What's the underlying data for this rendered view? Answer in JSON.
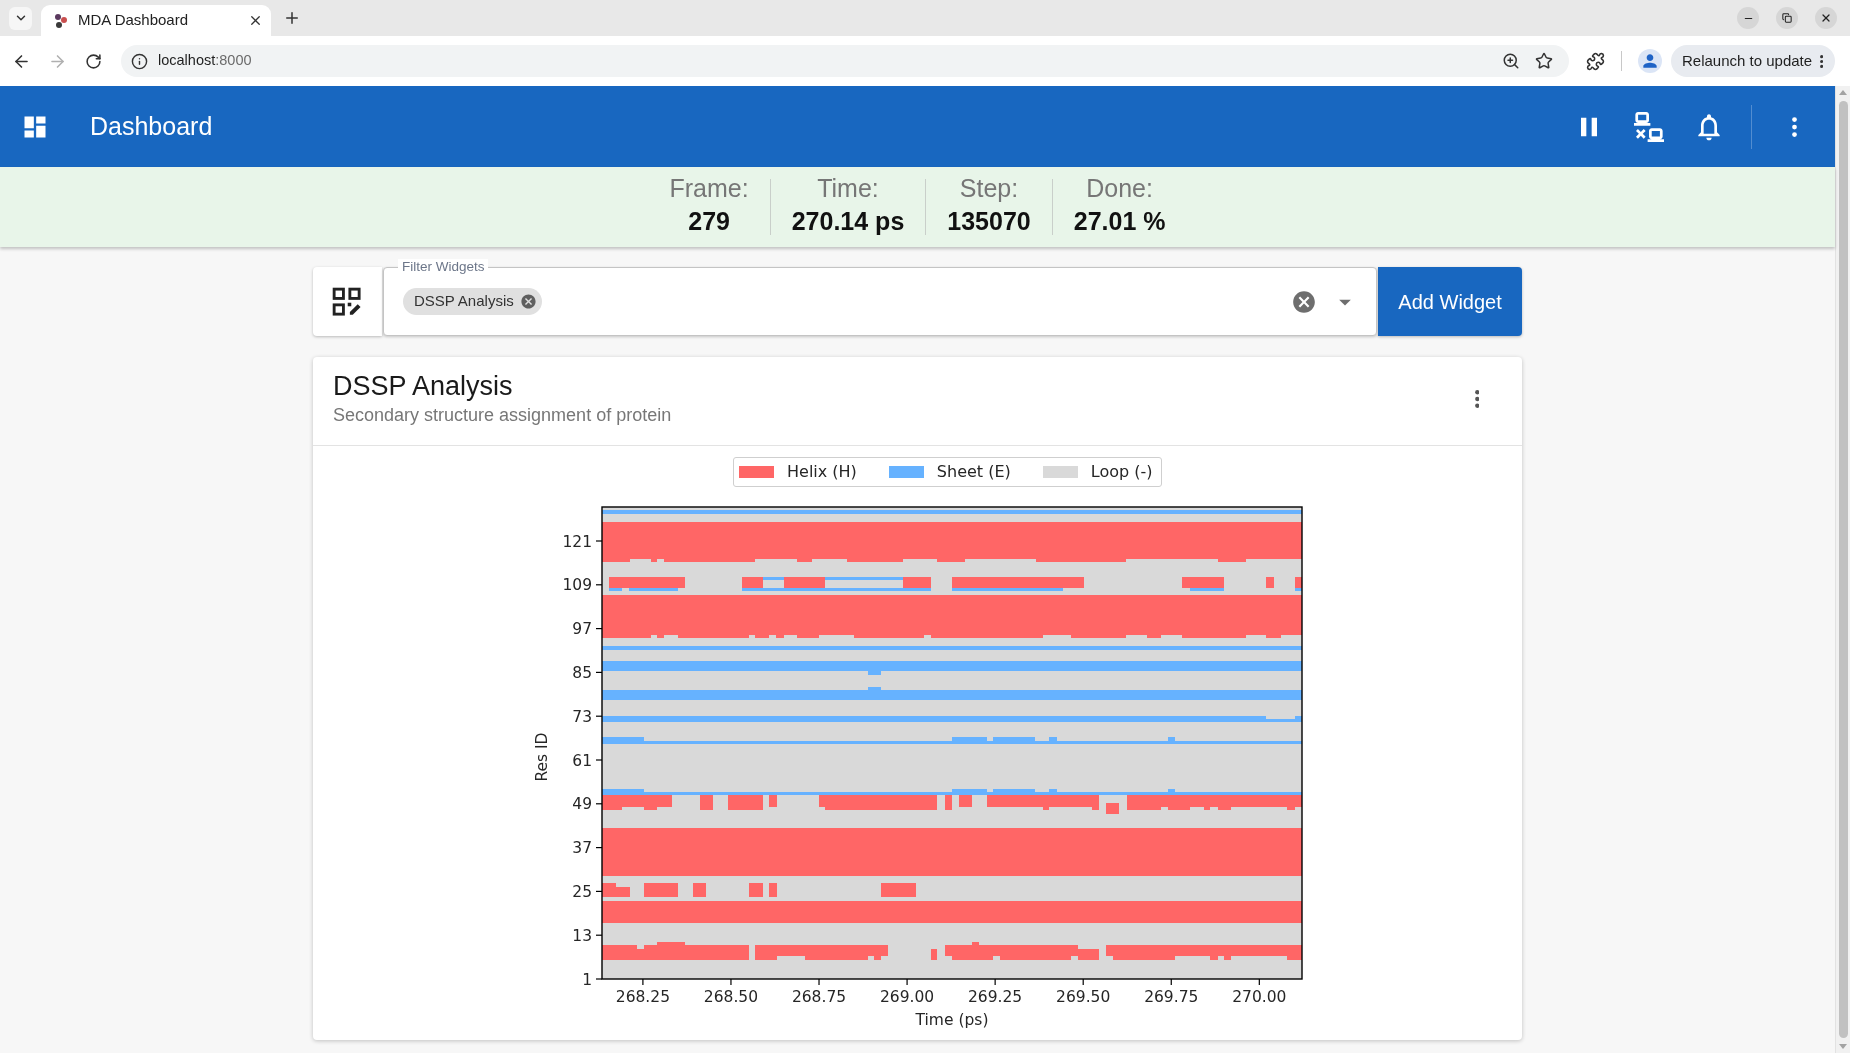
{
  "browser": {
    "tabs": [
      {
        "title": "MDA Dashboard",
        "selected": true
      }
    ],
    "address": {
      "host": "localhost",
      "port": ":8000"
    },
    "relaunch_button": "Relaunch to update"
  },
  "app_bar": {
    "title": "Dashboard"
  },
  "status": [
    {
      "label": "Frame:",
      "value": "279"
    },
    {
      "label": "Time:",
      "value": "270.14 ps"
    },
    {
      "label": "Step:",
      "value": "135070"
    },
    {
      "label": "Done:",
      "value": "27.01 %"
    }
  ],
  "filter": {
    "label": "Filter Widgets",
    "chips": [
      {
        "label": "DSSP Analysis"
      }
    ]
  },
  "add_widget_button": "Add Widget",
  "widgets": [
    {
      "title": "DSSP Analysis",
      "subtitle": "Secondary structure assignment of protein",
      "plot": {
        "legend": [
          {
            "label": "Helix (H)",
            "color": "#ff6666"
          },
          {
            "label": "Sheet (E)",
            "color": "#66b2ff"
          },
          {
            "label": "Loop (-)",
            "color": "#d9d9d9"
          }
        ],
        "xlabel": "Time (ps)",
        "ylabel": "Res ID",
        "xticks": [
          "268.25",
          "268.50",
          "268.75",
          "269.00",
          "269.25",
          "269.50",
          "269.75",
          "270.00"
        ],
        "yticks": [
          "121",
          "109",
          "97",
          "85",
          "73",
          "61",
          "49",
          "37",
          "25",
          "13",
          "1"
        ]
      }
    }
  ]
}
